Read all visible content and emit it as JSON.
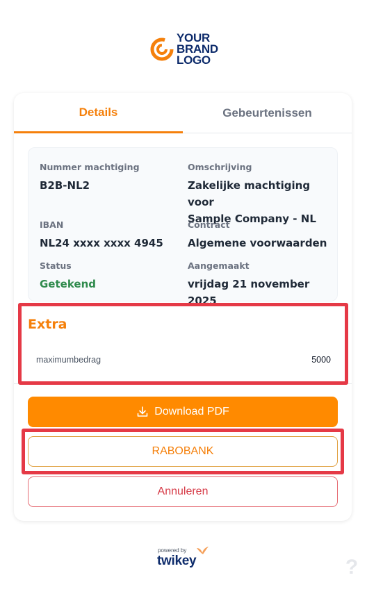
{
  "logo": {
    "line1": "YOUR",
    "line2": "BRAND",
    "line3": "LOGO"
  },
  "tabs": [
    {
      "label": "Details",
      "active": true
    },
    {
      "label": "Gebeurtenissen",
      "active": false
    }
  ],
  "details": {
    "mandate_number": {
      "label": "Nummer machtiging",
      "value": "B2B-NL2"
    },
    "description": {
      "label": "Omschrijving",
      "value_line1": "Zakelijke machtiging voor",
      "value_line2": "Sample Company - NL"
    },
    "iban": {
      "label": "IBAN",
      "value": "NL24 xxxx xxxx 4945"
    },
    "contract": {
      "label": "Contract",
      "value": "Algemene voorwaarden"
    },
    "status": {
      "label": "Status",
      "value": "Getekend",
      "color": "#2f8a4c"
    },
    "created": {
      "label": "Aangemaakt",
      "value": "vrijdag 21 november 2025"
    }
  },
  "extra": {
    "title": "Extra",
    "rows": [
      {
        "key": "maximumbedrag",
        "value": "5000"
      }
    ]
  },
  "actions": {
    "download_label": "Download PDF",
    "bank_label": "RABOBANK",
    "cancel_label": "Annuleren"
  },
  "footer": {
    "powered_by": "powered by",
    "brand": "twikey"
  },
  "help": {
    "glyph": "?"
  },
  "colors": {
    "accent": "#f5800b",
    "primary_button": "#ff8a00",
    "danger": "#d63a47",
    "highlight_outline": "#e53946"
  }
}
